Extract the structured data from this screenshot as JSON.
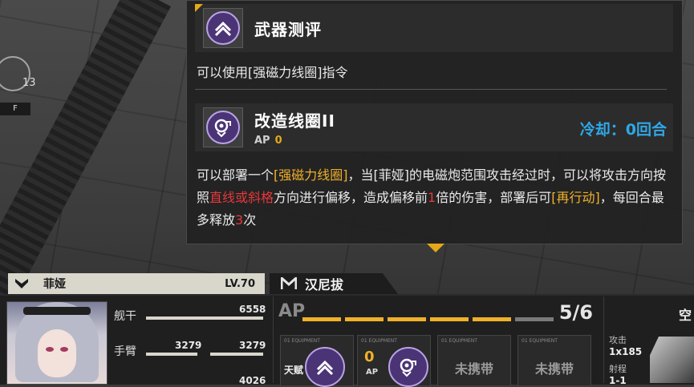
{
  "weapon_review": {
    "title": "武器测评",
    "description": "可以使用[强磁力线圈]指令"
  },
  "skill": {
    "name": "改造线圈II",
    "ap_label": "AP",
    "ap_value": "0",
    "cooldown": "冷却：0回合",
    "desc": {
      "p1": "可以部署一个",
      "h1": "[强磁力线圈]",
      "p2": "，当[菲娅]的电磁炮范围攻击经过时，可以将攻击方向按照",
      "h2": "直线或斜格",
      "p3": "方向进行偏移，造成偏移前",
      "h3": "1",
      "p4": "倍的伤害，部署后可",
      "h4": "[再行动]",
      "p5": "，每回合最多释放",
      "h5": "3",
      "p6": "次"
    }
  },
  "character": {
    "name": "菲娅",
    "level": "LV.70",
    "stats": {
      "ship_label": "舰干",
      "ship_value": "6558",
      "arm_label": "手臂",
      "arm_value_1": "3279",
      "arm_value_2": "3279",
      "third_value": "4026"
    }
  },
  "weapon": {
    "name": "汉尼拔"
  },
  "ap_panel": {
    "label": "AP",
    "count": "5/6",
    "segments_on": 5,
    "segments_total": 6,
    "slots": [
      {
        "tag": "01 EQUIPMENT",
        "corner": "天赋"
      },
      {
        "tag": "01 EQUIPMENT",
        "ap_num": "0",
        "ap_tag": "AP"
      },
      {
        "tag": "01 EQUIPMENT",
        "text": "未携带"
      },
      {
        "tag": "01 EQUIPMENT",
        "text": "未携带"
      }
    ]
  },
  "right_info": {
    "top": "空",
    "attack_label": "攻击",
    "attack_value": "1x185",
    "range_label": "射程",
    "range_value": "1-1"
  },
  "background": {
    "marker_number": "13",
    "marker_tag": "F"
  },
  "colors": {
    "accent_yellow": "#f0b12a",
    "accent_red": "#e5383b",
    "cooldown_blue": "#2fa8e8",
    "icon_purple": "#4a3475"
  }
}
